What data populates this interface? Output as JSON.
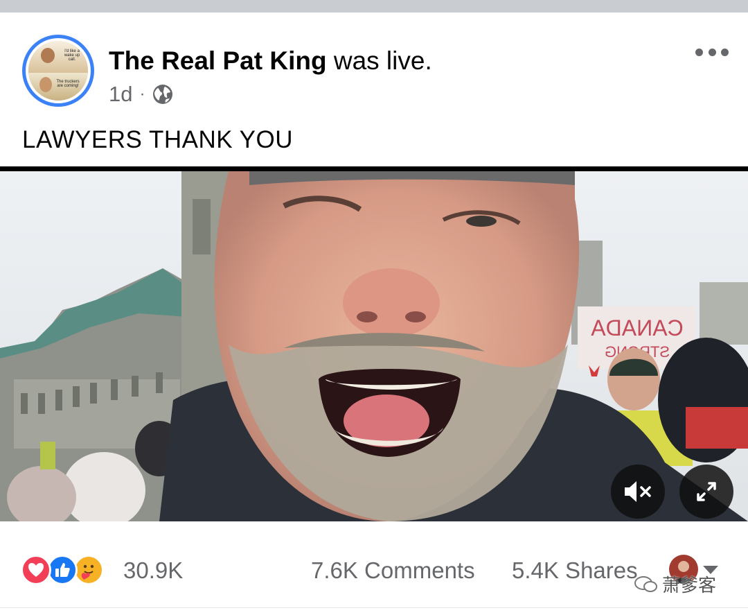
{
  "post": {
    "author": "The Real Pat King",
    "action": " was live.",
    "time": "1d",
    "separator": "·",
    "privacy_icon": "globe-icon",
    "more_icon": "more-options-icon",
    "caption": "LAWYERS THANK YOU"
  },
  "avatar": {
    "text_top": "I'd like a wake up call.",
    "text_bottom": "The truckers are coming!"
  },
  "video": {
    "sign_text_1": "CANADA",
    "sign_text_2": "STRONG",
    "mute_icon": "muted-speaker-icon",
    "expand_icon": "expand-icon"
  },
  "engagement": {
    "reactions": [
      "love-reaction-icon",
      "like-reaction-icon",
      "care-reaction-icon"
    ],
    "reaction_count": "30.9K",
    "comments": "7.6K Comments",
    "shares": "5.4K Shares",
    "watermark": "萧爹客"
  },
  "colors": {
    "top_bar": "#c9ccd1",
    "avatar_ring": "#3b82f6",
    "meta_gray": "#65676b",
    "love": "#f33e58",
    "like": "#1877f2",
    "care": "#f7b125"
  }
}
